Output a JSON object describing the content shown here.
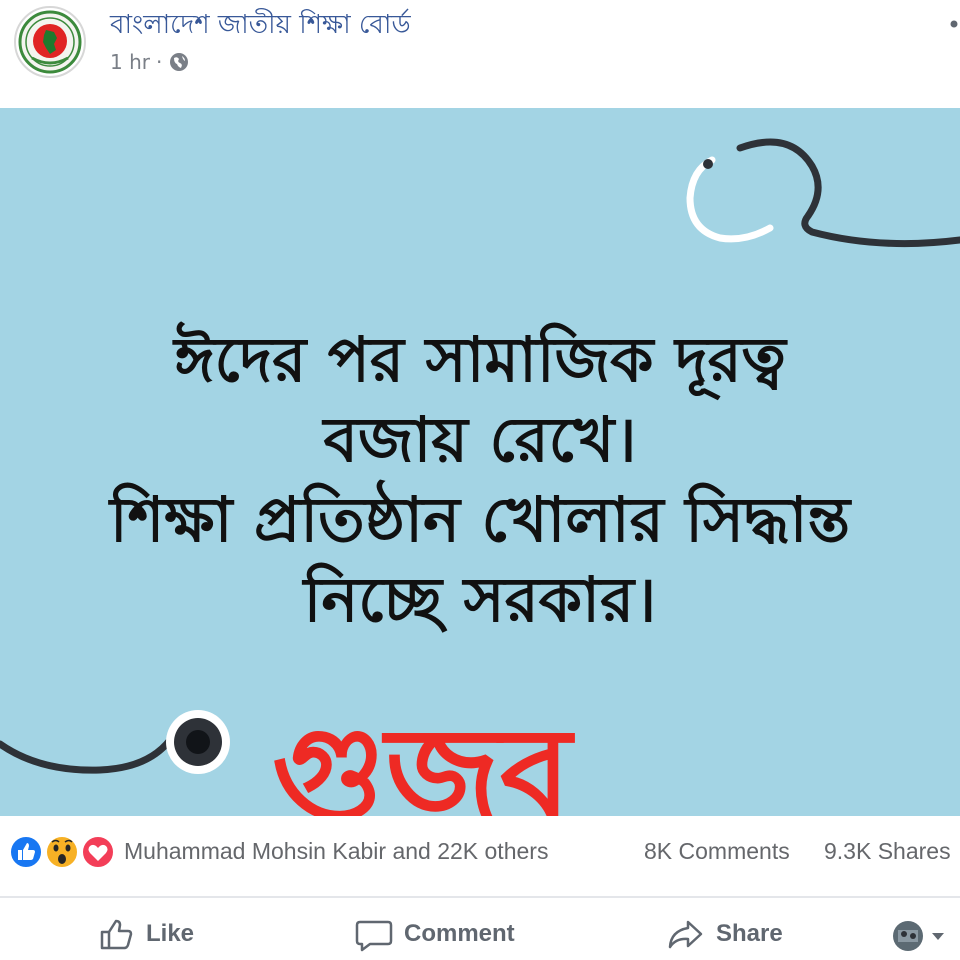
{
  "header": {
    "page_name": "বাংলাদেশ জাতীয় শিক্ষা বোর্ড",
    "time": "1 hr",
    "separator": "·",
    "privacy_icon": "globe-icon",
    "more_icon": "more-dots-icon"
  },
  "post_image": {
    "headline_lines": [
      "ঈদের পর সামাজিক দূরত্ব",
      "বজায় রেখে।",
      "শিক্ষা প্রতিষ্ঠান খোলার সিদ্ধান্ত",
      "নিচ্ছে সরকার।"
    ],
    "stamp_text": "গুজব",
    "background_color": "#a3d4e4",
    "stamp_color": "#ee2a24",
    "decoration_icon": "stethoscope-icon"
  },
  "reactions": {
    "icons": [
      "like-reaction-icon",
      "wow-reaction-icon",
      "love-reaction-icon"
    ],
    "reactors_text": "Muhammad Mohsin Kabir and 22K others",
    "comments_text": "8K Comments",
    "shares_text": "9.3K Shares"
  },
  "actions": {
    "like_label": "Like",
    "comment_label": "Comment",
    "share_label": "Share"
  },
  "colors": {
    "link_blue": "#385898",
    "meta_gray": "#65676b",
    "like_blue": "#1877f2",
    "love_red": "#f33e58",
    "wow_yellow": "#f7b125"
  }
}
